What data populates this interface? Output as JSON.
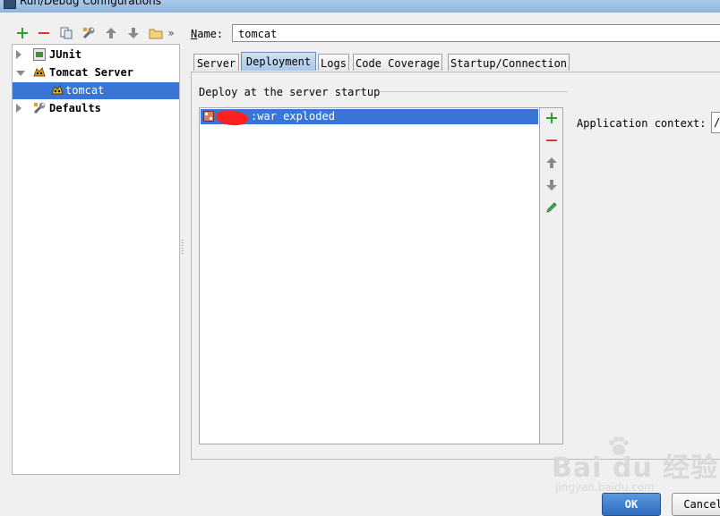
{
  "window": {
    "title": "Run/Debug Configurations"
  },
  "toolbar": {
    "icons": [
      "add-icon",
      "remove-icon",
      "copy-icon",
      "wrench-icon",
      "arrow-up-icon",
      "arrow-down-icon",
      "folder-icon",
      "more-icon"
    ],
    "more_label": "»"
  },
  "tree": {
    "items": [
      {
        "label": "JUnit",
        "icon": "junit-icon",
        "expanded": false
      },
      {
        "label": "Tomcat Server",
        "icon": "tomcat-icon",
        "expanded": true
      },
      {
        "label": "tomcat",
        "icon": "tomcat-config-icon",
        "selected": true
      },
      {
        "label": "Defaults",
        "icon": "wrench-icon",
        "expanded": false
      }
    ]
  },
  "form": {
    "name_label_underlined": "N",
    "name_label_rest": "ame:",
    "name_value": "tomcat"
  },
  "tabs": [
    {
      "label": "Server"
    },
    {
      "label": "Deployment",
      "active": true
    },
    {
      "label": "Logs"
    },
    {
      "label": "Code Coverage"
    },
    {
      "label": "Startup/Connection"
    }
  ],
  "deployment": {
    "section_label": "Deploy at the server startup",
    "artifact_text": ":war exploded",
    "artifact_icon": "artifact-icon",
    "side_buttons": [
      "add-icon",
      "remove-icon",
      "arrow-up-icon",
      "arrow-down-icon",
      "edit-icon"
    ],
    "context_label": "Application context:",
    "context_value": "/"
  },
  "buttons": {
    "ok": "OK",
    "cancel": "Cancel"
  },
  "watermark": {
    "brand": "Bai du 经验",
    "url": "jingyan.baidu.com"
  },
  "colors": {
    "selection": "#3875d7",
    "add": "#2ca02c",
    "remove": "#e0332c"
  }
}
